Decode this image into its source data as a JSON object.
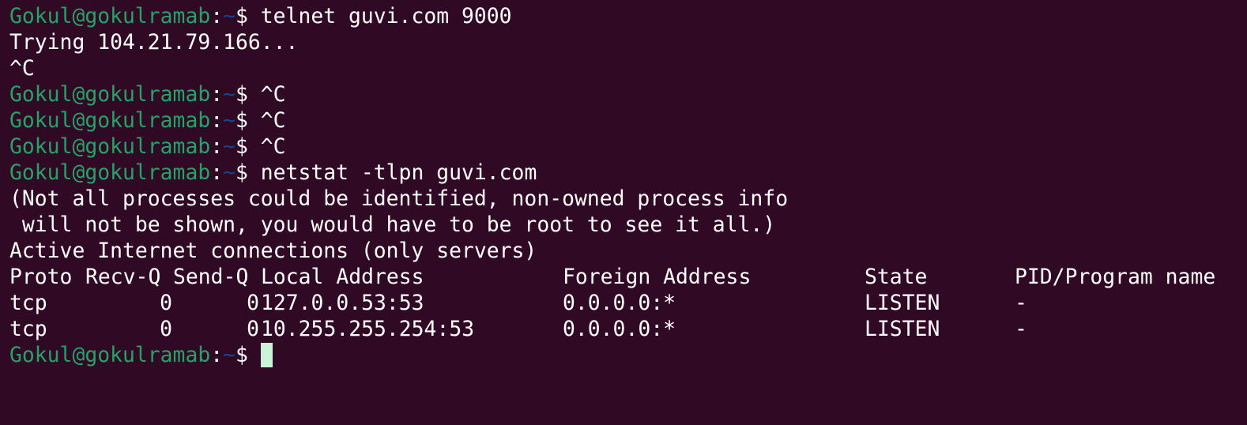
{
  "prompt": {
    "user_host": "Gokul@gokulramab",
    "colon": ":",
    "path": "~",
    "dollar": "$ "
  },
  "lines": {
    "cmd1": "telnet guvi.com 9000",
    "out1": "Trying 104.21.79.166...",
    "out2": "^C",
    "cmd2": "^C",
    "cmd3": "^C",
    "cmd4": "^C",
    "cmd5": "netstat -tlpn guvi.com",
    "out3": "(Not all processes could be identified, non-owned process info",
    "out4": " will not be shown, you would have to be root to see it all.)",
    "out5": "Active Internet connections (only servers)"
  },
  "netstat": {
    "headers": [
      "Proto",
      "Recv-Q",
      "Send-Q",
      "Local Address",
      "Foreign Address",
      "State",
      "PID/Program name"
    ],
    "rows": [
      [
        "tcp",
        "0",
        "0",
        "127.0.0.53:53",
        "0.0.0.0:*",
        "LISTEN",
        "-"
      ],
      [
        "tcp",
        "0",
        "0",
        "10.255.255.254:53",
        "0.0.0.0:*",
        "LISTEN",
        "-"
      ]
    ]
  },
  "colors": {
    "background": "#300a24",
    "prompt_user": "#26a269",
    "prompt_path": "#12488b",
    "text": "#ffffff",
    "cursor": "#c8f5d8"
  }
}
